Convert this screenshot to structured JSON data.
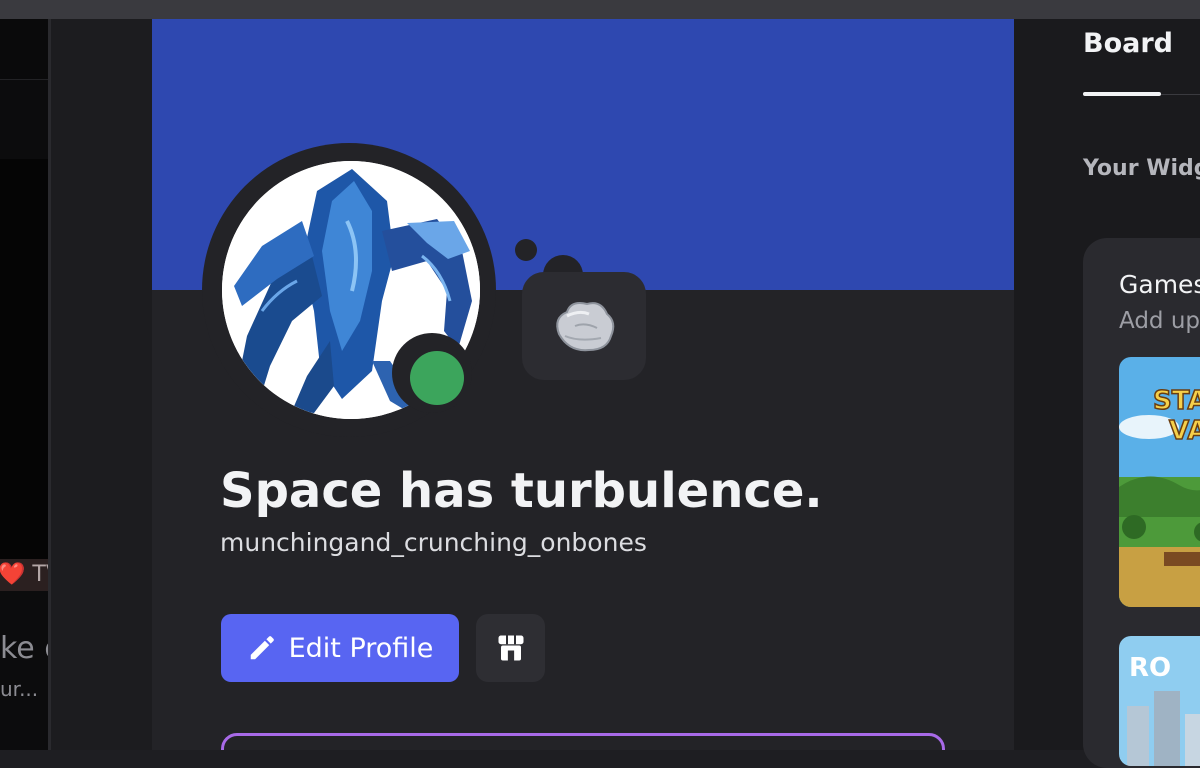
{
  "left_panel": {
    "tv_fragment": "❤️ TV",
    "line1_fragment": "ke c",
    "line2_fragment": "ur..."
  },
  "profile": {
    "display_name": "Space has turbulence.",
    "username": "munchingand_crunching_onbones",
    "status": "online",
    "edit_button_label": "Edit Profile",
    "colors": {
      "banner": "#2e48b0",
      "status_online": "#3ca55c",
      "primary_button": "#5865f2",
      "card_border": "#a86ae8"
    },
    "icons": {
      "avatar": "blue-creature-avatar",
      "bubble": "rock-emoji-icon",
      "edit": "pencil-icon",
      "shop": "shop-icon"
    }
  },
  "right_panel": {
    "tab_label": "Board",
    "widgets_label": "Your Widge",
    "games_title": "Games",
    "games_subtitle": "Add up",
    "game_tiles": [
      {
        "label": "STA VA",
        "icon": "stardew-game-tile"
      },
      {
        "label": "RO",
        "icon": "roblox-game-tile"
      }
    ]
  }
}
